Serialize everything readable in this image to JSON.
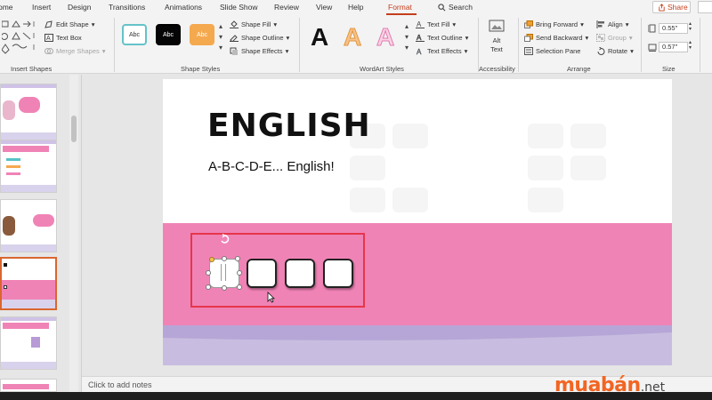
{
  "tabs": [
    "ome",
    "Insert",
    "Design",
    "Transitions",
    "Animations",
    "Slide Show",
    "Review",
    "View",
    "Help",
    "Format"
  ],
  "active_tab": "Format",
  "search_label": "Search",
  "share_label": "Share",
  "ribbon": {
    "insert_shapes": {
      "label": "Insert Shapes",
      "edit_shape": "Edit Shape",
      "text_box": "Text Box",
      "merge_shapes": "Merge Shapes"
    },
    "shape_styles": {
      "label": "Shape Styles",
      "presets": [
        "Abc",
        "Abc",
        "Abc"
      ],
      "shape_fill": "Shape Fill",
      "shape_outline": "Shape Outline",
      "shape_effects": "Shape Effects"
    },
    "wordart_styles": {
      "label": "WordArt Styles",
      "presets": [
        "A",
        "A",
        "A"
      ],
      "text_fill": "Text Fill",
      "text_outline": "Text Outline",
      "text_effects": "Text Effects"
    },
    "accessibility": {
      "label": "Accessibility",
      "alt_text_line1": "Alt",
      "alt_text_line2": "Text"
    },
    "arrange": {
      "label": "Arrange",
      "bring_forward": "Bring Forward",
      "send_backward": "Send Backward",
      "selection_pane": "Selection Pane",
      "align": "Align",
      "group": "Group",
      "rotate": "Rotate"
    },
    "size": {
      "label": "Size",
      "height": "0.55\"",
      "width": "0.57\""
    }
  },
  "slide": {
    "title": "ENGLISH",
    "subtitle": "A-B-C-D-E... English!"
  },
  "notes_placeholder": "Click to add notes",
  "watermark": {
    "brand": "muabán",
    "tld": ".net"
  },
  "colors": {
    "accent": "#c43e1c",
    "pink_band": "#f083b6",
    "highlight_box": "#e6364a",
    "watermark": "#f26522"
  }
}
